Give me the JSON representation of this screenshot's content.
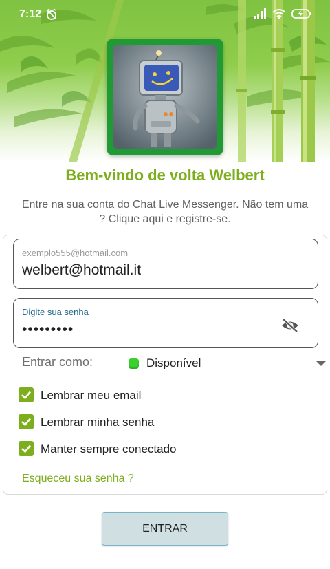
{
  "status_bar": {
    "time": "7:12"
  },
  "welcome": {
    "title": "Bem-vindo de volta Welbert",
    "subtitle": "Entre na sua conta do Chat Live Messenger. Não tem uma ? Clique aqui e registre-se."
  },
  "form": {
    "email": {
      "label": "exemplo555@hotmail.com",
      "value": "welbert@hotmail.it"
    },
    "password": {
      "label": "Digite sua senha",
      "masked_value": "•••••••••"
    },
    "status": {
      "label": "Entrar como:",
      "value": "Disponível",
      "color": "#3ad12f"
    },
    "checkboxes": [
      {
        "label": "Lembrar meu email",
        "checked": true
      },
      {
        "label": "Lembrar minha senha",
        "checked": true
      },
      {
        "label": "Manter sempre conectado",
        "checked": true
      }
    ],
    "forgot_link": "Esqueceu sua senha ?"
  },
  "actions": {
    "enter_label": "ENTRAR"
  },
  "colors": {
    "accent_green": "#7cae1e",
    "avatar_frame": "#1f9a35",
    "button_bg": "#cfdfe2",
    "button_border": "#78b5c9"
  }
}
